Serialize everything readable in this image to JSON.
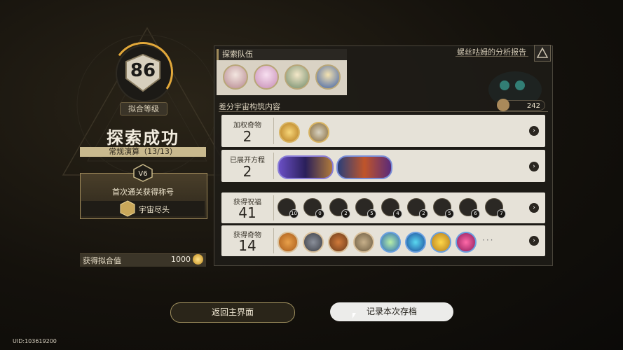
{
  "level": {
    "value": "86",
    "label": "拟合等级"
  },
  "result": {
    "title": "探索成功",
    "mode": "常规演算（13/13）",
    "badge": "V6"
  },
  "first_clear": {
    "title": "首次通关获得称号",
    "reward": "宇宙尽头"
  },
  "points": {
    "label": "获得拟合值",
    "value": "1000"
  },
  "team": {
    "label": "探索队伍",
    "members": [
      "character-1",
      "character-2",
      "character-3",
      "character-4"
    ]
  },
  "report": {
    "label": "螺丝咕姆的分析报告"
  },
  "construct": {
    "label": "差分宇宙构筑内容",
    "count": "242"
  },
  "rows": {
    "weighted_curios": {
      "label": "加权奇物",
      "count": "2"
    },
    "equations": {
      "label": "已展开方程",
      "count": "2"
    },
    "blessings": {
      "label": "获得祝福",
      "count": "41",
      "items": [
        {
          "icon": "blessing-preservation-icon",
          "count": "10"
        },
        {
          "icon": "blessing-remembrance-icon",
          "count": "0"
        },
        {
          "icon": "blessing-nihility-icon",
          "count": "2"
        },
        {
          "icon": "blessing-abundance-icon",
          "count": "5"
        },
        {
          "icon": "blessing-hunt-icon",
          "count": "4"
        },
        {
          "icon": "blessing-destruction-icon",
          "count": "2"
        },
        {
          "icon": "blessing-elation-icon",
          "count": "5"
        },
        {
          "icon": "blessing-propagation-icon",
          "count": "6"
        },
        {
          "icon": "blessing-erudition-icon",
          "count": "7"
        }
      ]
    },
    "curios": {
      "label": "获得奇物",
      "count": "14",
      "more": "···"
    }
  },
  "buttons": {
    "back": "返回主界面",
    "save": "记录本次存档"
  },
  "uid": "UID:103619200",
  "colors": {
    "accent": "#e2a83a",
    "gold": "#9f8a5a",
    "row_bg": "#e6e2d8"
  }
}
